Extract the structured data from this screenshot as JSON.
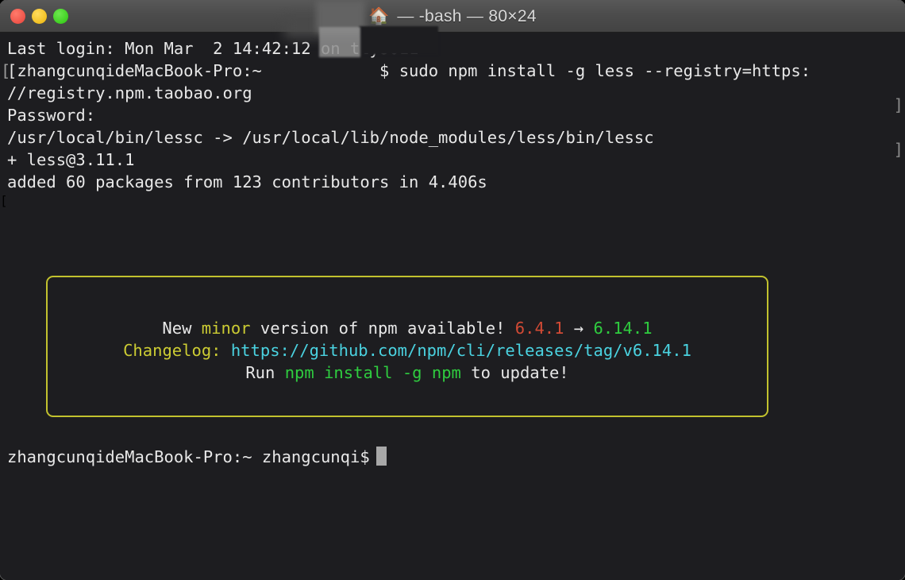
{
  "window": {
    "title": "— -bash — 80×24",
    "icon": "house-icon",
    "icon_glyph": "🏠",
    "background": "#1d1d20",
    "titlebar_color": "#4c4c4c",
    "traffic_lights": [
      {
        "name": "close",
        "color": "#ef5349"
      },
      {
        "name": "minimize",
        "color": "#f1c022"
      },
      {
        "name": "zoom",
        "color": "#3fd022"
      }
    ]
  },
  "terminal": {
    "lines": [
      {
        "text": "Last login: Mon Mar  2 14:42:12 on ttys011"
      },
      {
        "text": "[zhangcunqideMacBook-Pro:~            $ sudo npm install -g less --registry=https:]"
      },
      {
        "text": "//registry.npm.taobao.org"
      },
      {
        "text": "[Password:"
      },
      {
        "text": "/usr/local/bin/lessc -> /usr/local/lib/node_modules/less/bin/lessc"
      },
      {
        "text": "+ less@3.11.1"
      },
      {
        "text": "added 60 packages from 123 contributors in 4.406s"
      }
    ],
    "line1": "Last login: Mon Mar  2 14:42:12 on ttys011",
    "line2_prefix": "[zhangcunqideMacBook-Pro:~",
    "line2_prompt": "$ sudo npm install -g less --registry=https:",
    "line3": "//registry.npm.taobao.org",
    "line4": "Password:",
    "line5": "/usr/local/bin/lessc -> /usr/local/lib/node_modules/less/bin/lessc",
    "line6": "+ less@3.11.1",
    "line7": "added 60 packages from 123 contributors in 4.406s",
    "edge_mark_1": "]",
    "edge_mark_2": "]",
    "left_bracket_2": "[",
    "left_bracket_4": "[",
    "prompt": {
      "host_user": "zhangcunqideMacBook-Pro:~ zhangcunqi$",
      "cursor": "block"
    }
  },
  "npm_notice": {
    "border_color": "#c2c22e",
    "line1": {
      "part1": "New ",
      "minor": "minor",
      "part2": " version of npm available! ",
      "current_version": "6.4.1",
      "arrow": " → ",
      "new_version": "6.14.1"
    },
    "line2": {
      "label": "Changelog: ",
      "url": "https://github.com/npm/cli/releases/tag/v6.14.1"
    },
    "line3": {
      "part1": "Run ",
      "command": "npm install -g npm",
      "part2": " to update!"
    }
  },
  "colors": {
    "white": "#e8e8e8",
    "yellow": "#cccc33",
    "red": "#d24a35",
    "green": "#2fcc3f",
    "cyan": "#4ad2e0",
    "background": "#1d1d20"
  }
}
